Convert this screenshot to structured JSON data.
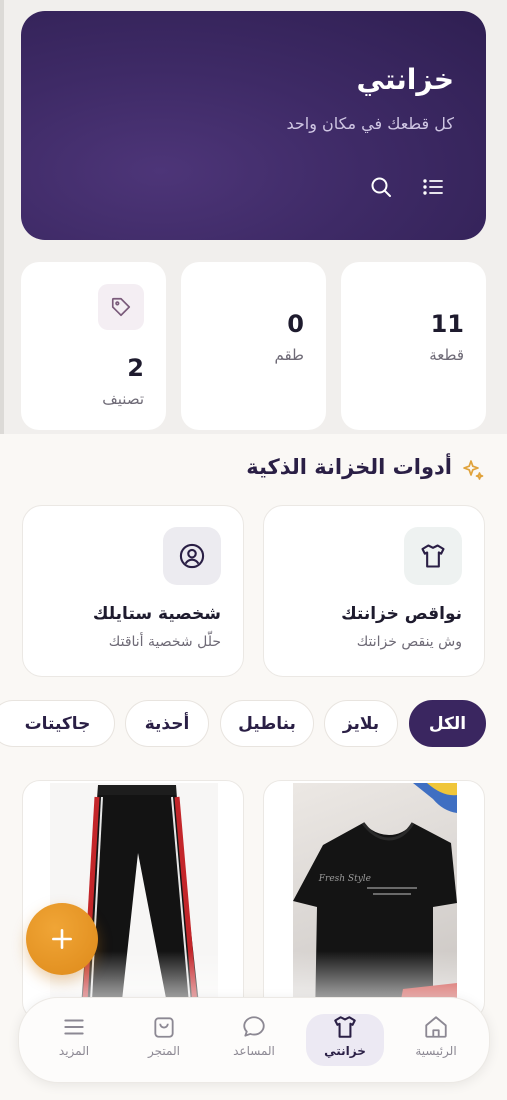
{
  "header": {
    "title": "خزانتي",
    "subtitle": "كل قطعك في مكان واحد",
    "menu_icon": "list-icon",
    "search_icon": "search-icon"
  },
  "stats": [
    {
      "value": "11",
      "label": "قطعة"
    },
    {
      "value": "0",
      "label": "طقم"
    },
    {
      "value": "2",
      "label": "تصنيف",
      "icon": "tag-icon"
    }
  ],
  "tools_section": {
    "title": "أدوات الخزانة الذكية",
    "icon": "sparkle-icon",
    "cards": [
      {
        "title": "نواقص خزانتك",
        "subtitle": "وش ينقص خزانتك",
        "icon": "shirt-icon"
      },
      {
        "title": "شخصية ستايلك",
        "subtitle": "حلّل شخصية أناقتك",
        "icon": "user-circle-icon"
      }
    ]
  },
  "filters": {
    "chips": [
      "الكل",
      "بلايز",
      "بناطيل",
      "أحذية",
      "جاكيتات"
    ],
    "selected": "الكل"
  },
  "items": [
    {
      "name": "t-shirt-photo"
    },
    {
      "name": "track-pants-photo"
    }
  ],
  "fab": {
    "icon": "plus-icon"
  },
  "nav": {
    "items": [
      {
        "label": "الرئيسية",
        "icon": "home-icon"
      },
      {
        "label": "خزانتي",
        "icon": "shirt-icon"
      },
      {
        "label": "المساعد",
        "icon": "chat-icon"
      },
      {
        "label": "المتجر",
        "icon": "bag-icon"
      },
      {
        "label": "المزيد",
        "icon": "menu-icon"
      }
    ],
    "active": "خزانتي"
  },
  "colors": {
    "primary": "#3a2660",
    "accent": "#e4951f",
    "background": "#faf8f5"
  }
}
